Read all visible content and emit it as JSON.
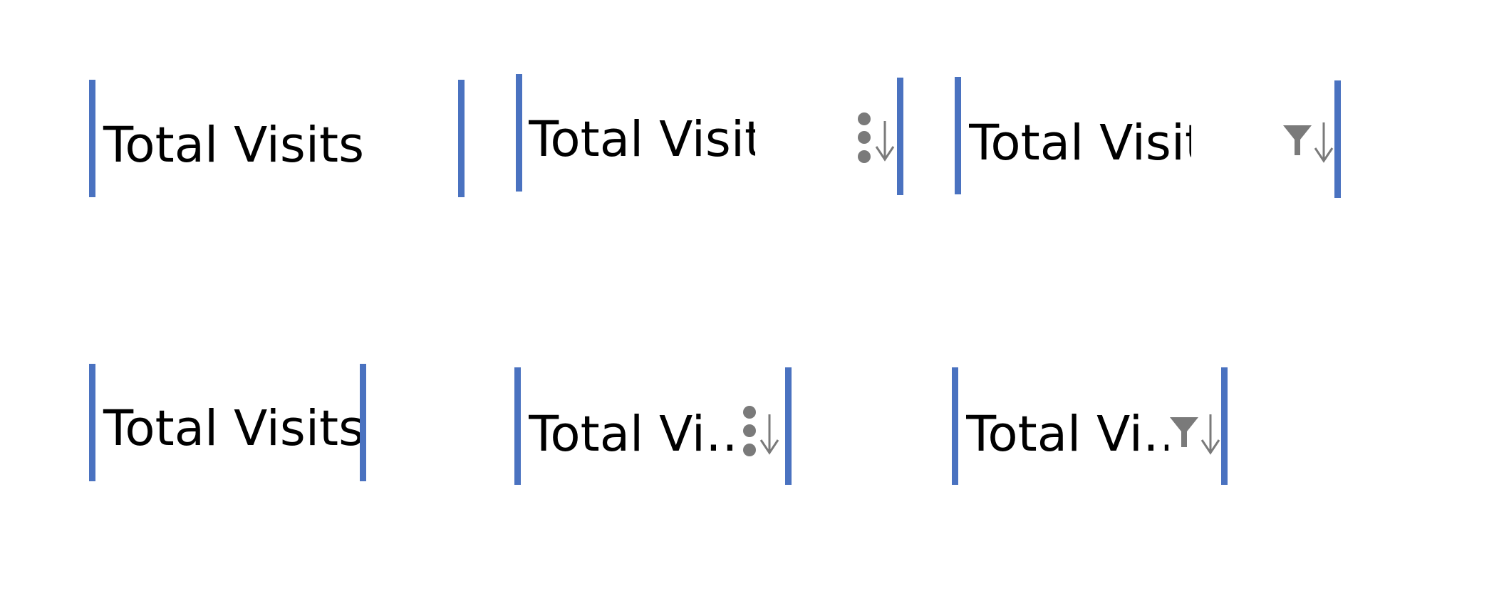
{
  "headers": {
    "row1": {
      "plain": {
        "label": "Total Visits"
      },
      "menu": {
        "label": "Total Visit",
        "menu_icon": "more-vertical-icon",
        "sort_icon": "sort-descending-icon"
      },
      "filter": {
        "label": "Total Visit",
        "filter_icon": "filter-icon",
        "sort_icon": "sort-descending-icon"
      }
    },
    "row2": {
      "plain": {
        "label": "Total Visits"
      },
      "menu": {
        "label": "Total Vi…",
        "menu_icon": "more-vertical-icon",
        "sort_icon": "sort-descending-icon"
      },
      "filter": {
        "label": "Total Vi…",
        "filter_icon": "filter-icon",
        "sort_icon": "sort-descending-icon"
      }
    }
  },
  "colors": {
    "boundary": "#4a72c0",
    "icon": "#7a7a7a",
    "text": "#000000"
  }
}
